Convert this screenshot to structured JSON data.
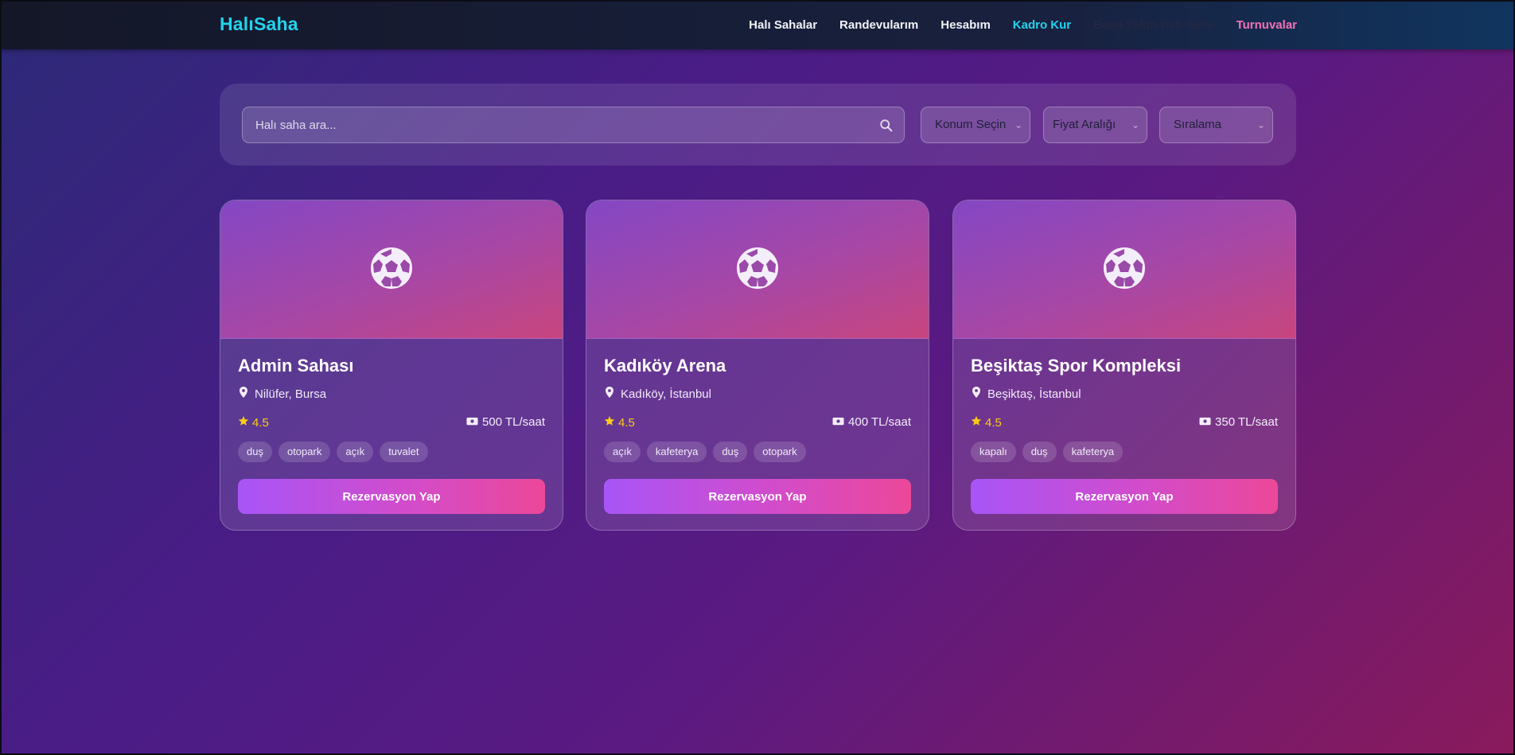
{
  "nav": {
    "brand": "HalıSaha",
    "links": [
      {
        "label": "Halı Sahalar"
      },
      {
        "label": "Randevularım"
      },
      {
        "label": "Hesabım"
      },
      {
        "label": "Kadro Kur"
      },
      {
        "label": "Bana Yakın Halı Saha"
      },
      {
        "label": "Turnuvalar"
      }
    ],
    "colors": {
      "brand": "#22d3ee",
      "highlight": "#22d3ee",
      "pink": "#f472b6"
    }
  },
  "search": {
    "placeholder": "Halı saha ara...",
    "value": "",
    "icon": "search-icon",
    "filters": {
      "location": "Konum Seçin",
      "price": "Fiyat Aralığı",
      "sort": "Sıralama"
    }
  },
  "venues": [
    {
      "name": "Admin Sahası",
      "location": "Nilüfer, Bursa",
      "rating": "4.5",
      "price": "500 TL/saat",
      "tags": [
        "duş",
        "otopark",
        "açık",
        "tuvalet"
      ],
      "button": "Rezervasyon Yap"
    },
    {
      "name": "Kadıköy Arena",
      "location": "Kadıköy, İstanbul",
      "rating": "4.5",
      "price": "400 TL/saat",
      "tags": [
        "açık",
        "kafeterya",
        "duş",
        "otopark"
      ],
      "button": "Rezervasyon Yap"
    },
    {
      "name": "Beşiktaş Spor Kompleksi",
      "location": "Beşiktaş, İstanbul",
      "rating": "4.5",
      "price": "350 TL/saat",
      "tags": [
        "kapalı",
        "duş",
        "kafeterya"
      ],
      "button": "Rezervasyon Yap"
    }
  ],
  "icons": {
    "hero": "soccer-ball-icon",
    "location": "map-pin-icon",
    "rating": "star-icon",
    "price": "money-bill-icon"
  },
  "colors": {
    "rating": "#facc15",
    "button_start": "#a855f7",
    "button_end": "#ec4899"
  }
}
